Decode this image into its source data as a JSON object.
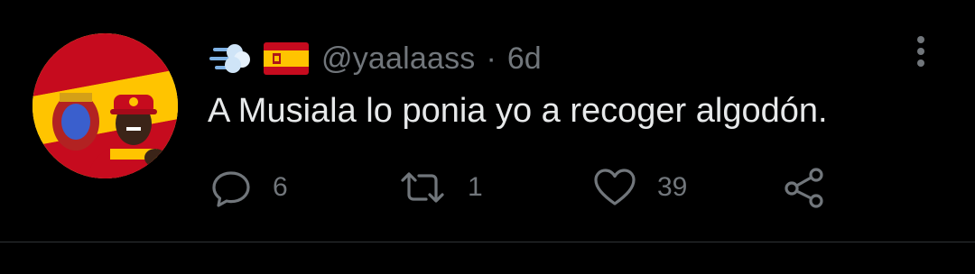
{
  "tweet": {
    "header_emojis": [
      "dash-emoji",
      "spain-flag-emoji"
    ],
    "handle": "@yaalaass",
    "separator": "·",
    "time": "6d",
    "text": "A Musiala lo ponia yo a recoger algodón."
  },
  "actions": {
    "reply_count": "6",
    "retweet_count": "1",
    "like_count": "39"
  },
  "icons": {
    "reply": "reply-icon",
    "retweet": "retweet-icon",
    "like": "heart-icon",
    "share": "share-icon",
    "more": "more-options-icon"
  },
  "colors": {
    "background": "#000000",
    "text_primary": "#e7e9ea",
    "text_secondary": "#71767b",
    "divider": "#2f3336",
    "flag_red": "#c60b1e",
    "flag_yellow": "#ffc400"
  }
}
